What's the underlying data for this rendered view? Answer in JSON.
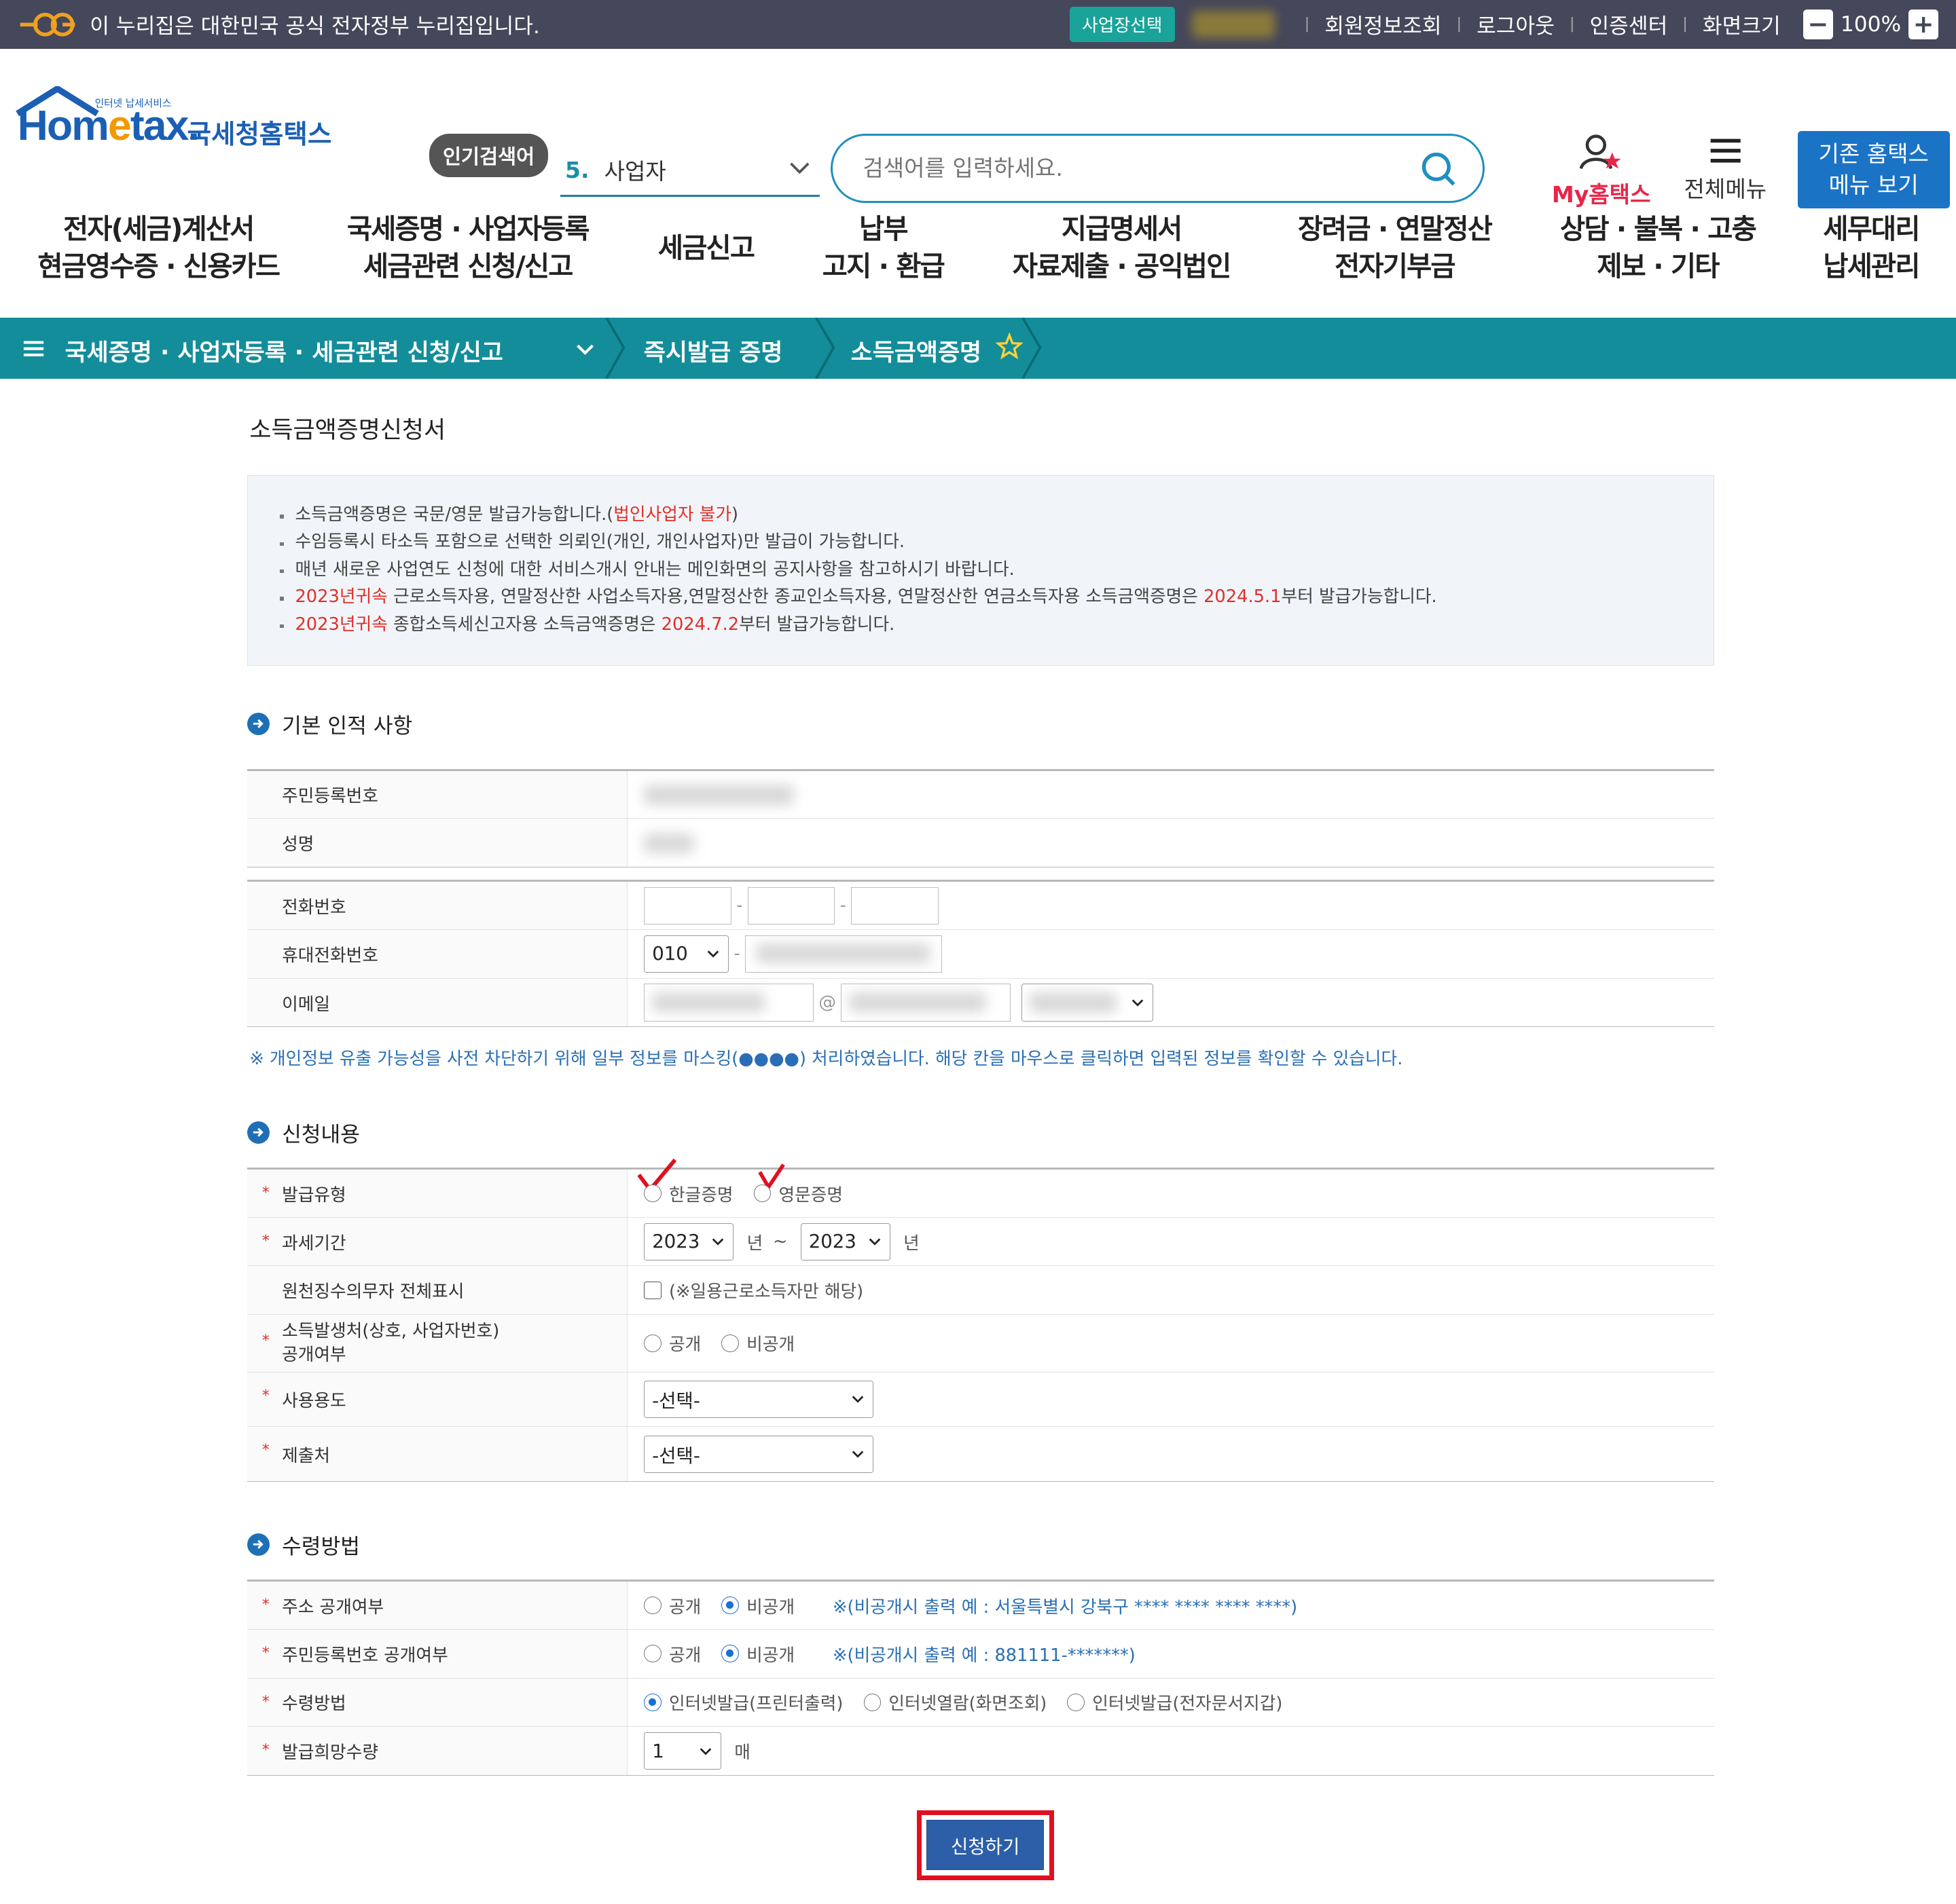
{
  "gov_banner": {
    "text": "이 누리집은 대한민국 공식 전자정부 누리집입니다.",
    "biz_select": "사업장선택",
    "links": [
      "회원정보조회",
      "로그아웃",
      "인증센터",
      "화면크기"
    ],
    "zoom": "100%",
    "zoom_minus": "−",
    "zoom_plus": "+"
  },
  "header": {
    "logo_main": "Hom",
    "logo_e": "e",
    "logo_rest": "tax.",
    "logo_kor": "국세청홈택스",
    "logo_mini": "인터넷 납세서비스",
    "popular_badge": "인기검색어",
    "popular_num": "5.",
    "popular_term": "사업자",
    "search_placeholder": "검색어를 입력하세요.",
    "my_hometax": "My홈택스",
    "all_menu": "전체메뉴",
    "old_menu_line1": "기존 홈택스",
    "old_menu_line2": "메뉴 보기"
  },
  "gnb": [
    {
      "l1": "전자(세금)계산서",
      "l2": "현금영수증 · 신용카드"
    },
    {
      "l1": "국세증명 · 사업자등록",
      "l2": "세금관련 신청/신고"
    },
    {
      "l1": "세금신고",
      "l2": ""
    },
    {
      "l1": "납부",
      "l2": "고지 · 환급"
    },
    {
      "l1": "지급명세서",
      "l2": "자료제출 · 공익법인"
    },
    {
      "l1": "장려금 · 연말정산",
      "l2": "전자기부금"
    },
    {
      "l1": "상담 · 불복 · 고충",
      "l2": "제보 · 기타"
    },
    {
      "l1": "세무대리",
      "l2": "납세관리"
    }
  ],
  "location": {
    "level1": "국세증명 · 사업자등록 · 세금관련 신청/신고",
    "level2": "즉시발급 증명",
    "level3": "소득금액증명"
  },
  "page_title": "소득금액증명신청서",
  "notice": {
    "n1_a": "소득금액증명은 국문/영문 발급가능합니다.(",
    "n1_red": "법인사업자 불가",
    "n1_b": ")",
    "n2": "수임등록시 타소득 포함으로 선택한 의뢰인(개인, 개인사업자)만 발급이 가능합니다.",
    "n3": "매년 새로운 사업연도 신청에 대한 서비스개시 안내는 메인화면의 공지사항을 참고하시기 바랍니다.",
    "n4_red": "2023년귀속",
    "n4_a": " 근로소득자용, 연말정산한 사업소득자용,연말정산한 종교인소득자용, 연말정산한 연금소득자용 소득금액증명은 ",
    "n4_red2": "2024.5.1",
    "n4_b": "부터 발급가능합니다.",
    "n5_red": "2023년귀속",
    "n5_a": " 종합소득세신고자용 소득금액증명은 ",
    "n5_red2": "2024.7.2",
    "n5_b": "부터 발급가능합니다."
  },
  "basic": {
    "heading": "기본 인적 사항",
    "rrn_label": "주민등록번호",
    "name_label": "성명",
    "tel_label": "전화번호",
    "mobile_label": "휴대전화번호",
    "mobile_prefix": "010",
    "email_label": "이메일",
    "email_at": "@",
    "dash": "-",
    "mask_note": "※ 개인정보 유출 가능성을 사전 차단하기 위해 일부 정보를 마스킹(●●●●) 처리하였습니다. 해당 칸을 마우스로 클릭하면 입력된 정보를 확인할 수 있습니다."
  },
  "apply": {
    "heading": "신청내용",
    "type_label": "발급유형",
    "type_opt1": "한글증명",
    "type_opt2": "영문증명",
    "period_label": "과세기간",
    "period_from": "2023",
    "period_to": "2023",
    "year_unit": "년",
    "tilde": "~",
    "withholding_label": "원천징수의무자 전체표시",
    "withholding_note": "(※일용근로소득자만 해당)",
    "source_label_l1": "소득발생처(상호, 사업자번호)",
    "source_label_l2": "공개여부",
    "open": "공개",
    "closed": "비공개",
    "usage_label": "사용용도",
    "usage_value": "-선택-",
    "submit_to_label": "제출처",
    "submit_to_value": "-선택-"
  },
  "receive": {
    "heading": "수령방법",
    "addr_label": "주소 공개여부",
    "addr_note": "※(비공개시 출력 예 : 서울특별시 강북구 **** **** **** ****)",
    "rrn_label": "주민등록번호 공개여부",
    "rrn_note": "※(비공개시 출력 예 : 881111-*******)",
    "method_label": "수령방법",
    "method_opt1": "인터넷발급(프린터출력)",
    "method_opt2": "인터넷열람(화면조회)",
    "method_opt3": "인터넷발급(전자문서지갑)",
    "qty_label": "발급희망수량",
    "qty_value": "1",
    "qty_unit": "매",
    "open": "공개",
    "closed": "비공개"
  },
  "submit_button": "신청하기",
  "colors": {
    "accent": "#138d9a",
    "brand_blue": "#1b5fb5",
    "red": "#e0302a",
    "check_mark": "#e01020"
  }
}
